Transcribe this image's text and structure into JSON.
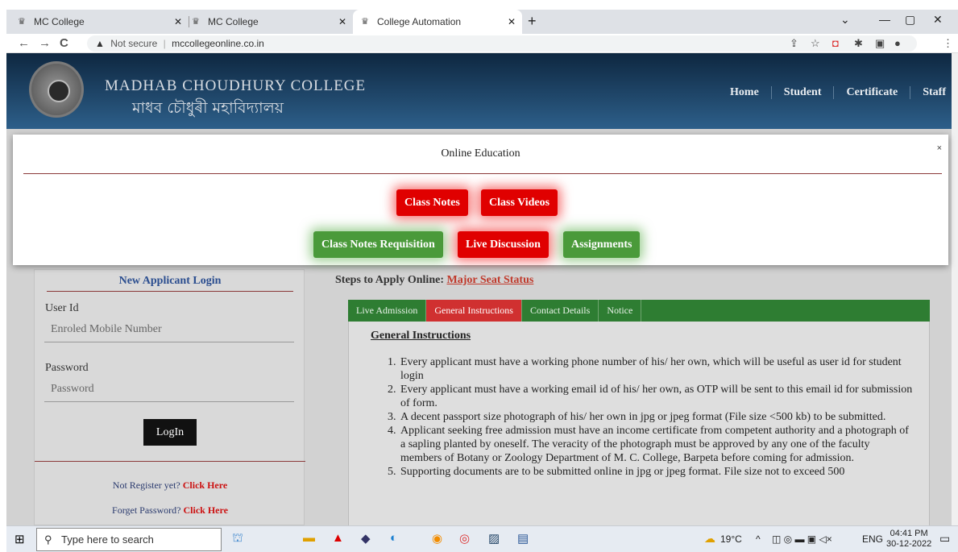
{
  "browser": {
    "tabs": [
      {
        "title": "MC College"
      },
      {
        "title": "MC College"
      },
      {
        "title": "College Automation"
      }
    ],
    "new_tab": "+",
    "minimize": "—",
    "restore": "▢",
    "close": "✕",
    "tab_list": "⌄",
    "security_label": "Not secure",
    "url": "mccollegeonline.co.in"
  },
  "site": {
    "name_en": "MADHAB CHOUDHURY COLLEGE",
    "name_bn": "মাধব চৌধুৰী মহাবিদ্যালয়",
    "nav": [
      "Home",
      "Student",
      "Certificate",
      "Staff"
    ]
  },
  "modal": {
    "title": "Online Education",
    "close": "×",
    "buttons_row1": [
      "Class Notes",
      "Class Videos"
    ],
    "buttons_row2": [
      "Class Notes Requisition",
      "Live Discussion",
      "Assignments"
    ]
  },
  "login": {
    "title": "New Applicant Login",
    "user_label": "User Id",
    "user_placeholder": "Enroled Mobile Number",
    "pass_label": "Password",
    "pass_placeholder": "Password",
    "button": "LogIn",
    "register_text": "Not Register yet?",
    "register_link": "Click Here",
    "forgot_text": "Forget Password?",
    "forgot_link": "Click Here"
  },
  "steps": {
    "label": "Steps to Apply Online:",
    "link": "Major Seat Status"
  },
  "info_tabs": [
    "Live Admission",
    "General Instructions",
    "Contact Details",
    "Notice"
  ],
  "instructions": {
    "title": "General Instructions",
    "items": [
      "Every applicant must have a working phone number of his/ her own, which will be useful as user id for student login",
      "Every applicant must have a working email id of his/ her own, as OTP will be sent to this email id for submission of form.",
      "A decent passport size photograph of his/ her own in jpg or jpeg format (File size <500 kb) to be submitted.",
      "Applicant seeking free admission must have an income certificate from competent authority and a photograph of a sapling planted by oneself. The veracity of the photograph must be approved by any one of the faculty members of Botany or Zoology Department of M. C. College, Barpeta before coming for admission.",
      "Supporting documents are to be submitted online in jpg or jpeg format. File size not to exceed 500"
    ]
  },
  "taskbar": {
    "search_placeholder": "Type here to search",
    "temperature": "19°C",
    "language": "ENG",
    "time": "04:41 PM",
    "date": "30-12-2022"
  }
}
